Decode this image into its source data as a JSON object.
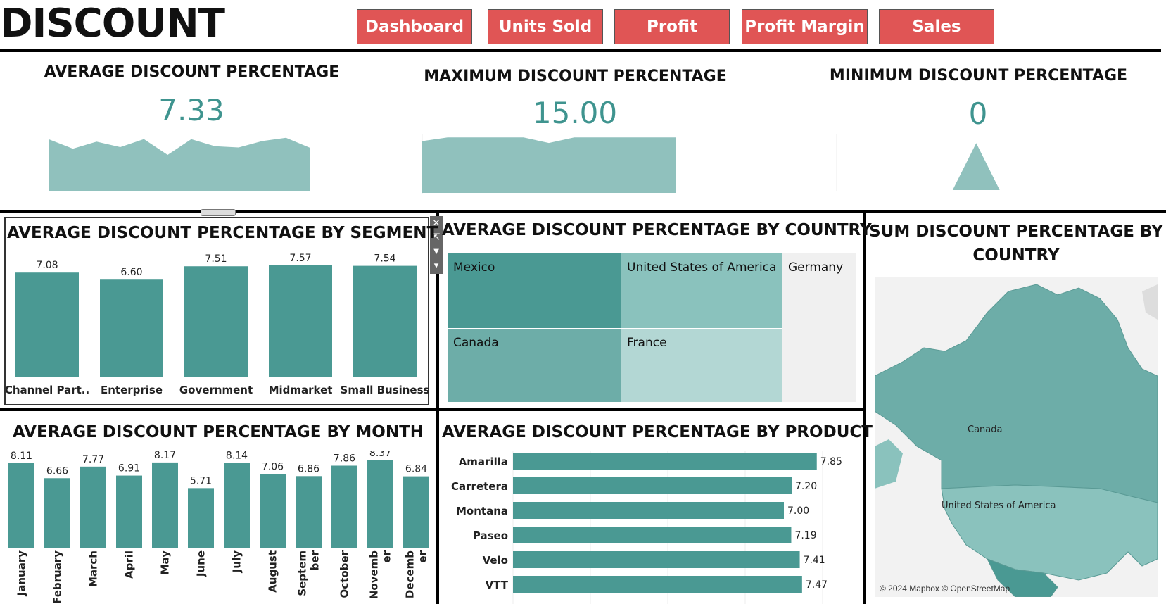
{
  "header": {
    "title": "DISCOUNT",
    "nav": [
      "Dashboard",
      "Units Sold",
      "Profit",
      "Profit Margin",
      "Sales"
    ],
    "nav_color": "#e05555"
  },
  "kpis": [
    {
      "title": "AVERAGE DISCOUNT PERCENTAGE",
      "value": "7.33"
    },
    {
      "title": "MAXIMUM DISCOUNT PERCENTAGE",
      "value": "15.00"
    },
    {
      "title": "MINIMUM DISCOUNT PERCENTAGE",
      "value": "0"
    }
  ],
  "accent_color": "#4a9993",
  "chart_data": [
    {
      "type": "area",
      "id": "avg-sparkline",
      "values": [
        8.11,
        6.66,
        7.77,
        6.91,
        8.17,
        5.71,
        8.14,
        7.06,
        6.86,
        7.86,
        8.37,
        6.84
      ],
      "ylim": [
        0,
        9
      ]
    },
    {
      "type": "area",
      "id": "max-sparkline",
      "values": [
        14,
        15,
        15,
        15,
        15,
        13.5,
        15,
        15,
        15,
        15,
        15
      ],
      "ylim": [
        0,
        16
      ]
    },
    {
      "type": "area",
      "id": "min-sparkline",
      "values": [
        0,
        0,
        0,
        0,
        0,
        10,
        0,
        0,
        0,
        0,
        0,
        0
      ],
      "ylim": [
        0,
        12
      ]
    },
    {
      "type": "bar",
      "id": "segment",
      "title": "AVERAGE DISCOUNT PERCENTAGE BY SEGMENT",
      "categories": [
        "Channel Part..",
        "Enterprise",
        "Government",
        "Midmarket",
        "Small Business"
      ],
      "values": [
        7.08,
        6.6,
        7.51,
        7.57,
        7.54
      ],
      "ylim": [
        0,
        8
      ]
    },
    {
      "type": "heatmap",
      "id": "country-treemap",
      "title": "AVERAGE DISCOUNT PERCENTAGE BY COUNTRY",
      "categories": [
        "Mexico",
        "United States of America",
        "Germany",
        "Canada",
        "France"
      ],
      "colors": [
        "#4a9993",
        "#8ac2bd",
        "#f0f0f0",
        "#6dada8",
        "#b3d7d4"
      ]
    },
    {
      "type": "bar",
      "id": "month",
      "title": "AVERAGE DISCOUNT PERCENTAGE BY MONTH",
      "categories": [
        "January",
        "February",
        "March",
        "April",
        "May",
        "June",
        "July",
        "August",
        "Septem ber",
        "October",
        "Novemb er",
        "Decemb er"
      ],
      "values": [
        8.11,
        6.66,
        7.77,
        6.91,
        8.17,
        5.71,
        8.14,
        7.06,
        6.86,
        7.86,
        8.37,
        6.84
      ],
      "ylim": [
        0,
        8.5
      ]
    },
    {
      "type": "bar",
      "id": "product",
      "title": "AVERAGE DISCOUNT PERCENTAGE BY PRODUCT",
      "categories": [
        "Amarilla",
        "Carretera",
        "Montana",
        "Paseo",
        "Velo",
        "VTT"
      ],
      "values": [
        7.85,
        7.2,
        7.0,
        7.19,
        7.41,
        7.47
      ],
      "xlim": [
        0,
        8
      ]
    }
  ],
  "map": {
    "title_line1": "SUM DISCOUNT PERCENTAGE BY",
    "title_line2": "COUNTRY",
    "labels": [
      "Canada",
      "United States of America"
    ],
    "credit": "© 2024 Mapbox © OpenStreetMap"
  }
}
